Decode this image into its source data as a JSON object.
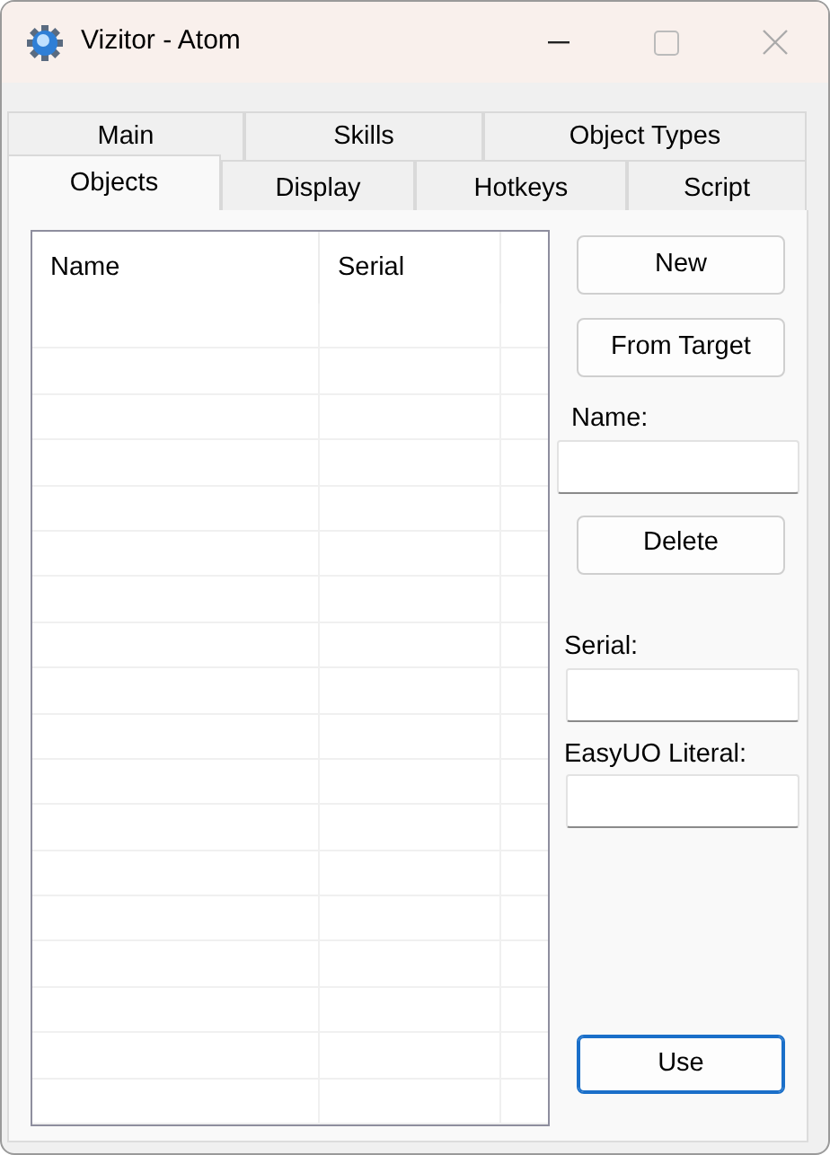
{
  "window": {
    "title": "Vizitor - Atom"
  },
  "tab_rows": [
    [
      {
        "label": "Main",
        "selected": false
      },
      {
        "label": "Skills",
        "selected": false
      },
      {
        "label": "Object Types",
        "selected": false
      }
    ],
    [
      {
        "label": "Objects",
        "selected": true
      },
      {
        "label": "Display",
        "selected": false
      },
      {
        "label": "Hotkeys",
        "selected": false
      },
      {
        "label": "Script",
        "selected": false
      }
    ]
  ],
  "list": {
    "columns": [
      "Name",
      "Serial"
    ]
  },
  "controls": [
    {
      "kind": "button",
      "label": "New"
    },
    {
      "kind": "button",
      "label": "From Target"
    },
    {
      "kind": "field",
      "label": "Name:"
    },
    {
      "kind": "button",
      "label": "Delete"
    },
    {
      "kind": "field",
      "label": "Serial:"
    },
    {
      "kind": "field",
      "label": "EasyUO Literal:"
    },
    {
      "kind": "default_button",
      "label": "Use"
    }
  ]
}
